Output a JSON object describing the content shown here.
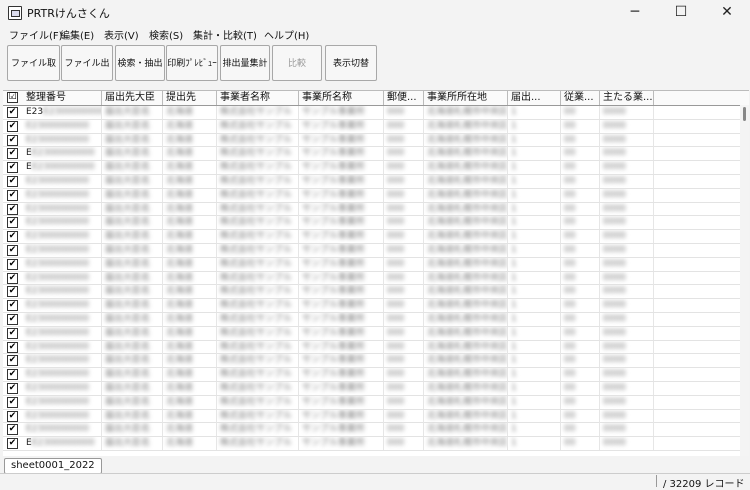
{
  "window": {
    "title": "PRTRけんさくん",
    "minimize": "─",
    "maximize": "☐",
    "close": "✕"
  },
  "menu": [
    "ファイル(F)",
    "編集(E)",
    "表示(V)",
    "検索(S)",
    "集計・比較(T)",
    "ヘルプ(H)"
  ],
  "toolbar": [
    {
      "label": "ファイル取込",
      "enabled": true
    },
    {
      "label": "ファイル出力",
      "enabled": true
    },
    {
      "label": "検索・抽出",
      "enabled": true
    },
    {
      "label": "印刷ﾌﾟﾚﾋﾞｭｰ",
      "enabled": true
    },
    {
      "label": "排出量集計",
      "enabled": true
    },
    {
      "label": "比較",
      "enabled": false
    },
    {
      "label": "表示切替",
      "enabled": true
    }
  ],
  "table": {
    "header_check": "☑",
    "columns": [
      "整理番号",
      "届出先大臣",
      "提出先",
      "事業者名称",
      "事業所名称",
      "郵便...",
      "事業所所在地",
      "届出...",
      "従業...",
      "主たる業..."
    ],
    "rows": [
      [
        "E23",
        "",
        "",
        "",
        "",
        "",
        "",
        "",
        "",
        ""
      ],
      [
        "",
        "",
        "",
        "",
        "",
        "",
        "",
        "",
        "",
        ""
      ],
      [
        "",
        "",
        "",
        "",
        "",
        "",
        "",
        "",
        "",
        ""
      ],
      [
        "E",
        "",
        "",
        "",
        "",
        "",
        "",
        "",
        "",
        ""
      ],
      [
        "E",
        "",
        "",
        "",
        "",
        "",
        "",
        "",
        "",
        ""
      ],
      [
        "",
        "",
        "",
        "",
        "",
        "",
        "",
        "",
        "",
        ""
      ],
      [
        "",
        "",
        "",
        "",
        "",
        "",
        "",
        "",
        "",
        ""
      ],
      [
        "",
        "",
        "",
        "",
        "",
        "",
        "",
        "",
        "",
        ""
      ],
      [
        "",
        "",
        "",
        "",
        "",
        "",
        "",
        "",
        "",
        ""
      ],
      [
        "",
        "",
        "",
        "",
        "",
        "",
        "",
        "",
        "",
        ""
      ],
      [
        "",
        "",
        "",
        "",
        "",
        "",
        "",
        "",
        "",
        ""
      ],
      [
        "",
        "",
        "",
        "",
        "",
        "",
        "",
        "",
        "",
        ""
      ],
      [
        "",
        "",
        "",
        "",
        "",
        "",
        "",
        "",
        "",
        ""
      ],
      [
        "",
        "",
        "",
        "",
        "",
        "",
        "",
        "",
        "",
        ""
      ],
      [
        "",
        "",
        "",
        "",
        "",
        "",
        "",
        "",
        "",
        ""
      ],
      [
        "",
        "",
        "",
        "",
        "",
        "",
        "",
        "",
        "",
        ""
      ],
      [
        "",
        "",
        "",
        "",
        "",
        "",
        "",
        "",
        "",
        ""
      ],
      [
        "",
        "",
        "",
        "",
        "",
        "",
        "",
        "",
        "",
        ""
      ],
      [
        "",
        "",
        "",
        "",
        "",
        "",
        "",
        "",
        "",
        ""
      ],
      [
        "",
        "",
        "",
        "",
        "",
        "",
        "",
        "",
        "",
        ""
      ],
      [
        "",
        "",
        "",
        "",
        "",
        "",
        "",
        "",
        "",
        ""
      ],
      [
        "",
        "",
        "",
        "",
        "",
        "",
        "",
        "",
        "",
        ""
      ],
      [
        "",
        "",
        "",
        "",
        "",
        "",
        "",
        "",
        "",
        ""
      ],
      [
        "",
        "",
        "",
        "",
        "",
        "",
        "",
        "",
        "",
        ""
      ],
      [
        "E",
        "",
        "",
        "",
        "",
        "",
        "",
        "",
        "",
        ""
      ]
    ]
  },
  "sheet_tab": "sheet0001_2022",
  "status": {
    "records": "/ 32209 レコード"
  }
}
